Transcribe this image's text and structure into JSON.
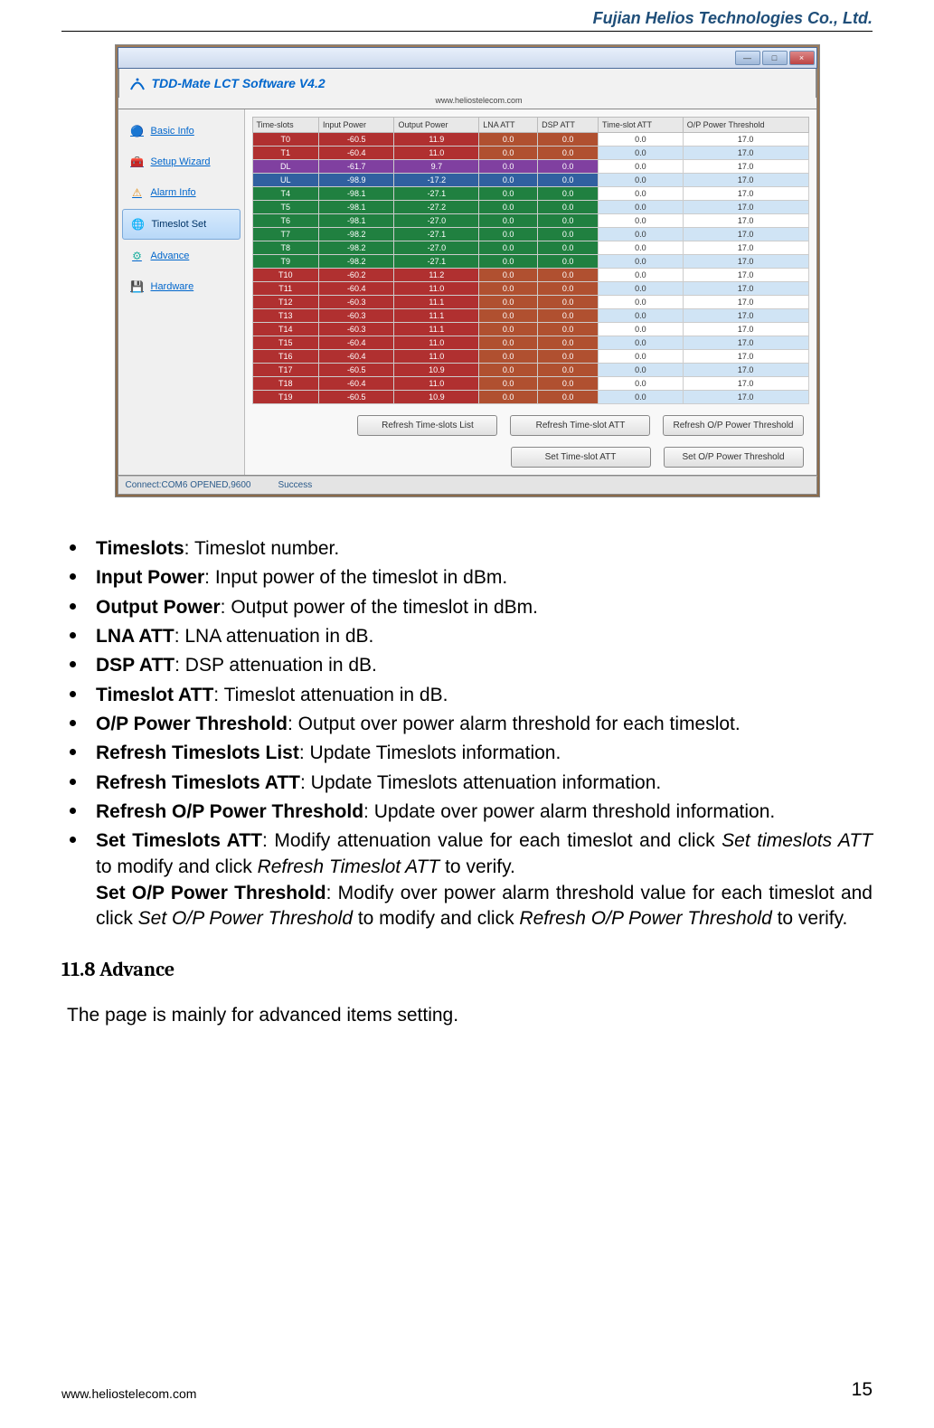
{
  "header": {
    "company": "Fujian Helios Technologies Co., Ltd."
  },
  "screenshot": {
    "app_title": "TDD-Mate LCT Software V4.2",
    "app_url": "www.heliostelecom.com",
    "window_controls": {
      "min": "—",
      "max": "□",
      "close": "×"
    },
    "sidebar": {
      "items": [
        {
          "label": "Basic Info",
          "icon": "🔵",
          "color": "#3080d0"
        },
        {
          "label": "Setup Wizard",
          "icon": "🧰",
          "color": "#b06030"
        },
        {
          "label": "Alarm Info",
          "icon": "⚠",
          "color": "#e09020"
        },
        {
          "label": "Timeslot Set",
          "icon": "🌐",
          "color": "#20a060",
          "selected": true
        },
        {
          "label": "Advance",
          "icon": "⚙",
          "color": "#20b0a0"
        },
        {
          "label": "Hardware",
          "icon": "💾",
          "color": "#5070a0"
        }
      ]
    },
    "table": {
      "headers": [
        "Time-slots",
        "Input Power",
        "Output Power",
        "LNA ATT",
        "DSP ATT",
        "Time-slot ATT",
        "O/P Power Threshold"
      ],
      "rows": [
        {
          "cells": [
            "T0",
            "-60.5",
            "11.9",
            "0.0",
            "0.0",
            "0.0",
            "17.0"
          ],
          "c": [
            "#b03030",
            "#b03030",
            "#b03030",
            "#b05030",
            "#b05030",
            "p",
            "p"
          ]
        },
        {
          "cells": [
            "T1",
            "-60.4",
            "11.0",
            "0.0",
            "0.0",
            "0.0",
            "17.0"
          ],
          "c": [
            "#b03030",
            "#b03030",
            "#b03030",
            "#b05030",
            "#b05030",
            "a",
            "a"
          ]
        },
        {
          "cells": [
            "DL",
            "-61.7",
            "9.7",
            "0.0",
            "0.0",
            "0.0",
            "17.0"
          ],
          "c": [
            "#8040a0",
            "#8040a0",
            "#8040a0",
            "#8040a0",
            "#8040a0",
            "p",
            "p"
          ]
        },
        {
          "cells": [
            "UL",
            "-98.9",
            "-17.2",
            "0.0",
            "0.0",
            "0.0",
            "17.0"
          ],
          "c": [
            "#3060a0",
            "#3060a0",
            "#3060a0",
            "#3060a0",
            "#3060a0",
            "a",
            "a"
          ]
        },
        {
          "cells": [
            "T4",
            "-98.1",
            "-27.1",
            "0.0",
            "0.0",
            "0.0",
            "17.0"
          ],
          "c": [
            "#208040",
            "#208040",
            "#208040",
            "#208040",
            "#208040",
            "p",
            "p"
          ]
        },
        {
          "cells": [
            "T5",
            "-98.1",
            "-27.2",
            "0.0",
            "0.0",
            "0.0",
            "17.0"
          ],
          "c": [
            "#208040",
            "#208040",
            "#208040",
            "#208040",
            "#208040",
            "a",
            "a"
          ]
        },
        {
          "cells": [
            "T6",
            "-98.1",
            "-27.0",
            "0.0",
            "0.0",
            "0.0",
            "17.0"
          ],
          "c": [
            "#208040",
            "#208040",
            "#208040",
            "#208040",
            "#208040",
            "p",
            "p"
          ]
        },
        {
          "cells": [
            "T7",
            "-98.2",
            "-27.1",
            "0.0",
            "0.0",
            "0.0",
            "17.0"
          ],
          "c": [
            "#208040",
            "#208040",
            "#208040",
            "#208040",
            "#208040",
            "a",
            "a"
          ]
        },
        {
          "cells": [
            "T8",
            "-98.2",
            "-27.0",
            "0.0",
            "0.0",
            "0.0",
            "17.0"
          ],
          "c": [
            "#208040",
            "#208040",
            "#208040",
            "#208040",
            "#208040",
            "p",
            "p"
          ]
        },
        {
          "cells": [
            "T9",
            "-98.2",
            "-27.1",
            "0.0",
            "0.0",
            "0.0",
            "17.0"
          ],
          "c": [
            "#208040",
            "#208040",
            "#208040",
            "#208040",
            "#208040",
            "a",
            "a"
          ]
        },
        {
          "cells": [
            "T10",
            "-60.2",
            "11.2",
            "0.0",
            "0.0",
            "0.0",
            "17.0"
          ],
          "c": [
            "#b03030",
            "#b03030",
            "#b03030",
            "#b05030",
            "#b05030",
            "p",
            "p"
          ]
        },
        {
          "cells": [
            "T11",
            "-60.4",
            "11.0",
            "0.0",
            "0.0",
            "0.0",
            "17.0"
          ],
          "c": [
            "#b03030",
            "#b03030",
            "#b03030",
            "#b05030",
            "#b05030",
            "a",
            "a"
          ]
        },
        {
          "cells": [
            "T12",
            "-60.3",
            "11.1",
            "0.0",
            "0.0",
            "0.0",
            "17.0"
          ],
          "c": [
            "#b03030",
            "#b03030",
            "#b03030",
            "#b05030",
            "#b05030",
            "p",
            "p"
          ]
        },
        {
          "cells": [
            "T13",
            "-60.3",
            "11.1",
            "0.0",
            "0.0",
            "0.0",
            "17.0"
          ],
          "c": [
            "#b03030",
            "#b03030",
            "#b03030",
            "#b05030",
            "#b05030",
            "a",
            "a"
          ]
        },
        {
          "cells": [
            "T14",
            "-60.3",
            "11.1",
            "0.0",
            "0.0",
            "0.0",
            "17.0"
          ],
          "c": [
            "#b03030",
            "#b03030",
            "#b03030",
            "#b05030",
            "#b05030",
            "p",
            "p"
          ]
        },
        {
          "cells": [
            "T15",
            "-60.4",
            "11.0",
            "0.0",
            "0.0",
            "0.0",
            "17.0"
          ],
          "c": [
            "#b03030",
            "#b03030",
            "#b03030",
            "#b05030",
            "#b05030",
            "a",
            "a"
          ]
        },
        {
          "cells": [
            "T16",
            "-60.4",
            "11.0",
            "0.0",
            "0.0",
            "0.0",
            "17.0"
          ],
          "c": [
            "#b03030",
            "#b03030",
            "#b03030",
            "#b05030",
            "#b05030",
            "p",
            "p"
          ]
        },
        {
          "cells": [
            "T17",
            "-60.5",
            "10.9",
            "0.0",
            "0.0",
            "0.0",
            "17.0"
          ],
          "c": [
            "#b03030",
            "#b03030",
            "#b03030",
            "#b05030",
            "#b05030",
            "a",
            "a"
          ]
        },
        {
          "cells": [
            "T18",
            "-60.4",
            "11.0",
            "0.0",
            "0.0",
            "0.0",
            "17.0"
          ],
          "c": [
            "#b03030",
            "#b03030",
            "#b03030",
            "#b05030",
            "#b05030",
            "p",
            "p"
          ]
        },
        {
          "cells": [
            "T19",
            "-60.5",
            "10.9",
            "0.0",
            "0.0",
            "0.0",
            "17.0"
          ],
          "c": [
            "#b03030",
            "#b03030",
            "#b03030",
            "#b05030",
            "#b05030",
            "a",
            "a"
          ]
        }
      ]
    },
    "buttons": {
      "refresh_list": "Refresh Time-slots List",
      "refresh_att": "Refresh Time-slot ATT",
      "refresh_op": "Refresh O/P Power Threshold",
      "set_att": "Set Time-slot ATT",
      "set_op": "Set O/P Power Threshold"
    },
    "status": {
      "conn": "Connect:COM6 OPENED,9600",
      "msg": "Success"
    }
  },
  "bullets": [
    {
      "term": "Timeslots",
      "desc": ": Timeslot number."
    },
    {
      "term": "Input Power",
      "desc": ": Input power of the timeslot in dBm."
    },
    {
      "term": "Output Power",
      "desc": ": Output power of the timeslot in dBm."
    },
    {
      "term": "LNA ATT",
      "desc": ": LNA attenuation in dB."
    },
    {
      "term": "DSP ATT",
      "desc": ": DSP attenuation in dB."
    },
    {
      "term": "Timeslot ATT",
      "desc": ": Timeslot attenuation in dB."
    },
    {
      "term": "O/P Power Threshold",
      "desc": ": Output over power alarm threshold for each timeslot."
    },
    {
      "term": "Refresh Timeslots List",
      "desc": ": Update Timeslots information."
    },
    {
      "term": "Refresh Timeslots ATT",
      "desc": ": Update Timeslots attenuation information."
    },
    {
      "term": "Refresh O/P Power Threshold",
      "desc": ": Update over power alarm threshold information."
    }
  ],
  "last_bullet": {
    "term": "Set Timeslots ATT",
    "p1a": ": Modify attenuation value for each timeslot and click ",
    "p1i": "Set timeslots ATT",
    "p1b": " to modify and click ",
    "p1i2": "Refresh Timeslot ATT",
    "p1c": " to verify.",
    "term2": "Set O/P Power Threshold",
    "p2a": ": Modify over power alarm threshold value for each timeslot and click ",
    "p2i": "Set O/P Power Threshold",
    "p2b": " to modify and click ",
    "p2i2": "Refresh O/P Power Threshold",
    "p2c": " to verify."
  },
  "section": {
    "heading": "11.8 Advance",
    "body": "The page is mainly for advanced items setting."
  },
  "footer": {
    "url": "www.heliostelecom.com",
    "page": "15"
  }
}
